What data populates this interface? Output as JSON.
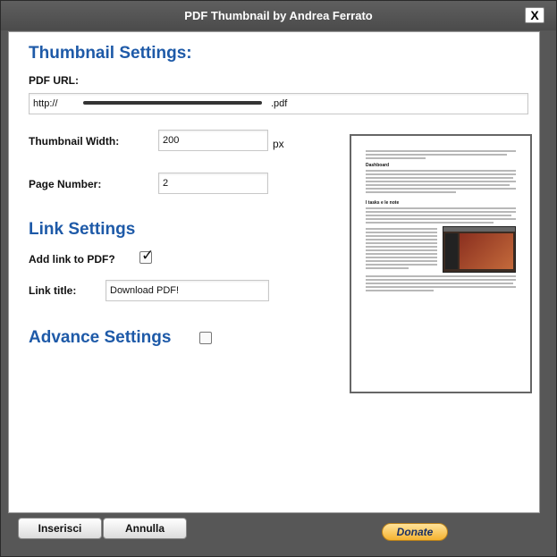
{
  "window": {
    "title": "PDF Thumbnail by Andrea Ferrato",
    "close_label": "X"
  },
  "thumbnail_settings": {
    "heading": "Thumbnail Settings:",
    "pdf_url_label": "PDF URL:",
    "pdf_url_value": "http://",
    "pdf_url_tail": ".pdf",
    "width_label": "Thumbnail Width:",
    "width_value": "200",
    "width_unit": "px",
    "page_label": "Page Number:",
    "page_value": "2"
  },
  "link_settings": {
    "heading": "Link Settings",
    "add_link_label": "Add link to PDF?",
    "add_link_checked": true,
    "link_title_label": "Link title:",
    "link_title_value": "Download PDF!"
  },
  "advance_settings": {
    "heading": "Advance Settings",
    "checked": false
  },
  "preview": {
    "section1": "Dashboard",
    "section2": "I tasks e le note"
  },
  "footer": {
    "insert_label": "Inserisci",
    "cancel_label": "Annulla",
    "donate_label": "Donate"
  },
  "colors": {
    "heading": "#1e5aa8",
    "titlebar": "#555555",
    "donate": "#f5b230"
  }
}
